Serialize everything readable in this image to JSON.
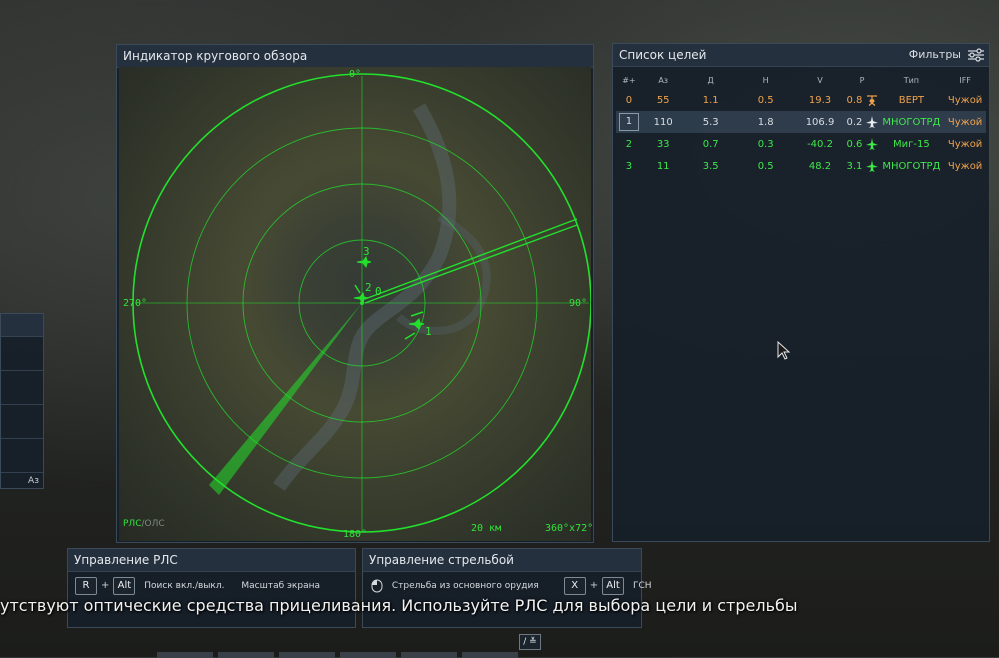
{
  "radar": {
    "title": "Индикатор кругового обзора",
    "bearing_top": "0°",
    "bearing_right": "90°",
    "bearing_bottom": "180°",
    "bearing_left": "270°",
    "mode_active": "РЛС",
    "mode_sep": "/",
    "mode_inactive": "ОЛС",
    "range": "20 км",
    "scan_zone": "360°x72°",
    "contacts": [
      {
        "label": "0"
      },
      {
        "label": "1"
      },
      {
        "label": "2"
      },
      {
        "label": "3"
      }
    ]
  },
  "targets": {
    "title": "Список целей",
    "filters_label": "Фильтры",
    "headers": [
      "#+",
      "Аз",
      "Д",
      "Н",
      "V",
      "Р",
      "Тип",
      "IFF"
    ],
    "rows": [
      {
        "idx": "0",
        "az": "55",
        "d": "1.1",
        "h": "0.5",
        "v": "19.3",
        "r": "0.8",
        "icon": "helicopter-icon",
        "type": "ВЕРТ",
        "iff": "Чужой",
        "style": "orange"
      },
      {
        "idx": "1",
        "az": "110",
        "d": "5.3",
        "h": "1.8",
        "v": "106.9",
        "r": "0.2",
        "icon": "jet-icon",
        "type": "МНОГОТРД",
        "iff": "Чужой",
        "style": "sel"
      },
      {
        "idx": "2",
        "az": "33",
        "d": "0.7",
        "h": "0.3",
        "v": "-40.2",
        "r": "0.6",
        "icon": "jet-icon",
        "type": "Миг-15",
        "iff": "Чужой",
        "style": "green"
      },
      {
        "idx": "3",
        "az": "11",
        "d": "3.5",
        "h": "0.5",
        "v": "48.2",
        "r": "3.1",
        "icon": "jet-icon",
        "type": "МНОГОТРД",
        "iff": "Чужой",
        "style": "green"
      }
    ]
  },
  "radar_control": {
    "title": "Управление РЛС",
    "key1": "R",
    "plus": "+",
    "key2": "Alt",
    "action1": "Поиск вкл./выкл.",
    "action2": "Масштаб экрана"
  },
  "fire_control": {
    "title": "Управление стрельбой",
    "action1": "Стрельба из основного орудия",
    "key1": "X",
    "plus": "+",
    "key2": "Alt",
    "action2": "ГСН"
  },
  "subtitle": "утствуют оптические средства прицеливания. Используйте РЛС для выбора цели и стрельбы",
  "left_stub": {
    "footer": "Аз"
  },
  "hint_key": "/ ≚",
  "colors": {
    "radar_green": "#22e02c",
    "hostile_orange": "#f0a24a",
    "target_green": "#3ee84a"
  }
}
